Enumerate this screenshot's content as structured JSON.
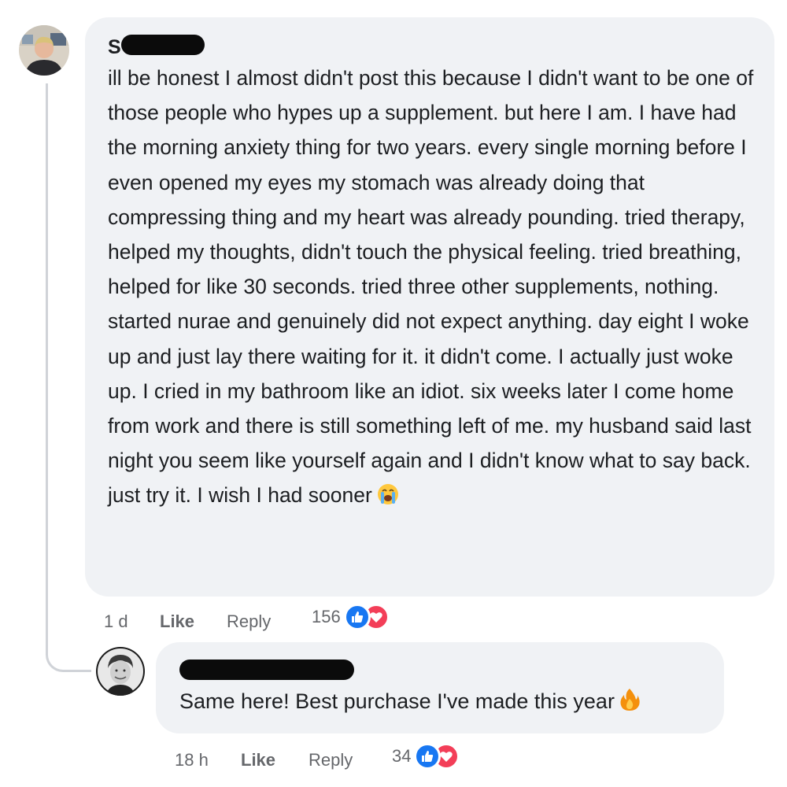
{
  "comment": {
    "author_visible": "S",
    "text": "ill be honest I almost didn't post this because I didn't want to be one of those people who hypes up a supplement. but here I am. I have had the morning anxiety thing for two years. every single morning before I even opened my eyes my stomach was already doing that compressing thing and my heart was already pounding. tried therapy, helped my thoughts, didn't touch the physical feeling. tried breathing, helped for like 30 seconds. tried three other supplements, nothing. started nurae and genuinely did not expect anything. day eight I woke up and just lay there waiting for it. it didn't come. I actually just woke up. I cried in my bathroom like an idiot. six weeks later I come home from work and there is still something left of me. my husband said last night you seem like yourself again and I didn't know what to say back. just try it. I wish I had sooner",
    "emoji": "loudly-crying-face-emoji",
    "time": "1 d",
    "like_label": "Like",
    "reply_label": "Reply",
    "reaction_count": "156",
    "reactions": [
      "like-icon",
      "heart-icon"
    ]
  },
  "reply": {
    "text": "Same here! Best purchase I've made this year",
    "emoji": "fire-emoji",
    "time": "18 h",
    "like_label": "Like",
    "reply_label": "Reply",
    "reaction_count": "34",
    "reactions": [
      "like-icon",
      "heart-icon"
    ]
  },
  "colors": {
    "bubble": "#f0f2f5",
    "text": "#1c1e21",
    "meta": "#65676b",
    "like_blue": "#1877f2",
    "love_red": "#f33e58"
  }
}
